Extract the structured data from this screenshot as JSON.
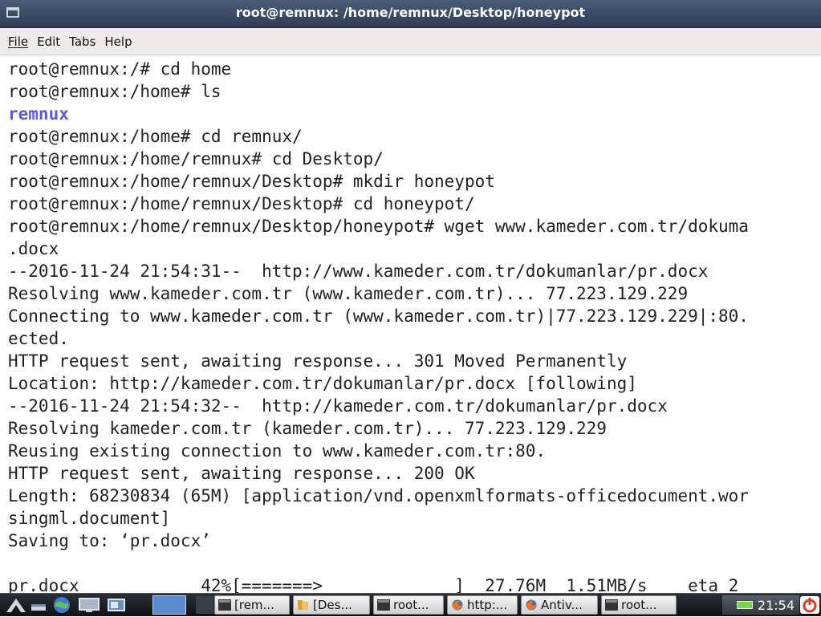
{
  "window": {
    "title": "root@remnux: /home/remnux/Desktop/honeypot"
  },
  "menu": {
    "items": [
      "File",
      "Edit",
      "Tabs",
      "Help"
    ]
  },
  "terminal": {
    "lines": [
      "root@remnux:/# cd home",
      "root@remnux:/home# ls",
      "remnux",
      "root@remnux:/home# cd remnux/",
      "root@remnux:/home/remnux# cd Desktop/",
      "root@remnux:/home/remnux/Desktop# mkdir honeypot",
      "root@remnux:/home/remnux/Desktop# cd honeypot/",
      "root@remnux:/home/remnux/Desktop/honeypot# wget www.kameder.com.tr/dokuma",
      ".docx",
      "--2016-11-24 21:54:31--  http://www.kameder.com.tr/dokumanlar/pr.docx",
      "Resolving www.kameder.com.tr (www.kameder.com.tr)... 77.223.129.229",
      "Connecting to www.kameder.com.tr (www.kameder.com.tr)|77.223.129.229|:80.",
      "ected.",
      "HTTP request sent, awaiting response... 301 Moved Permanently",
      "Location: http://kameder.com.tr/dokumanlar/pr.docx [following]",
      "--2016-11-24 21:54:32--  http://kameder.com.tr/dokumanlar/pr.docx",
      "Resolving kameder.com.tr (kameder.com.tr)... 77.223.129.229",
      "Reusing existing connection to www.kameder.com.tr:80.",
      "HTTP request sent, awaiting response... 200 OK",
      "Length: 68230834 (65M) [application/vnd.openxmlformats-officedocument.wor",
      "singml.document]",
      "Saving to: ‘pr.docx’",
      "",
      "pr.docx            42%[=======>             ]  27.76M  1.51MB/s    eta 2"
    ],
    "directory_line_index": 2,
    "colors": {
      "text": "#222222",
      "directory": "#5b5bd6",
      "background": "#ffffff"
    }
  },
  "taskbar": {
    "tasks": [
      {
        "label": "[rem...",
        "icon": "terminal-icon"
      },
      {
        "label": "[Des...",
        "icon": "folder-icon"
      },
      {
        "label": "root...",
        "icon": "terminal-icon"
      },
      {
        "label": "http:...",
        "icon": "firefox-icon"
      },
      {
        "label": "Antiv...",
        "icon": "firefox-icon"
      },
      {
        "label": "root...",
        "icon": "terminal-icon"
      }
    ],
    "clock": "21:54",
    "launchers": [
      "menu-icon",
      "minimize-all-icon",
      "globe-icon",
      "monitor-icon",
      "window-icon",
      "blue-square-icon"
    ]
  }
}
